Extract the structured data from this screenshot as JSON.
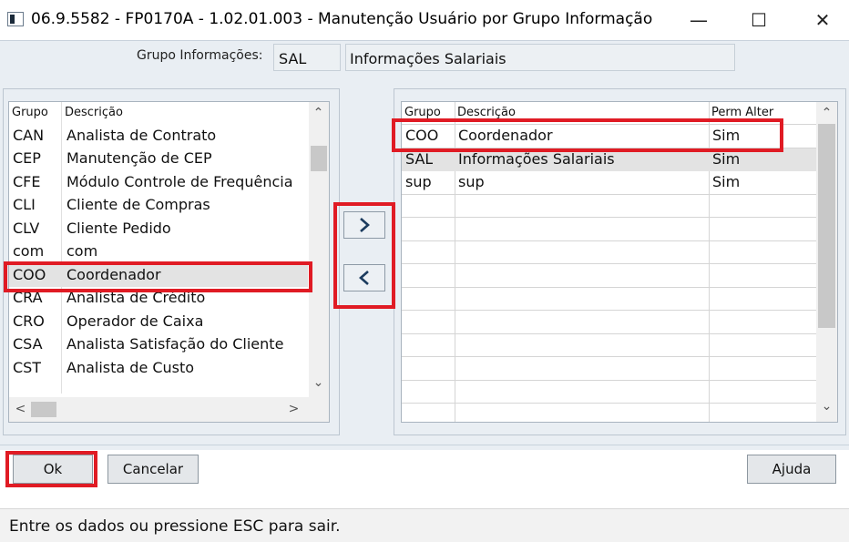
{
  "window": {
    "title": "06.9.5582 - FP0170A - 1.02.01.003 - Manutenção Usuário por Grupo Informação",
    "minimize": "—",
    "maximize": "☐",
    "close": "✕"
  },
  "header": {
    "grupo_label": "Grupo Informações:",
    "grupo_code": "SAL",
    "grupo_desc": "Informações Salariais"
  },
  "left_grid": {
    "col_grupo": "Grupo",
    "col_descricao": "Descrição",
    "rows": [
      {
        "grupo": "CAN",
        "descricao": "Analista de Contrato"
      },
      {
        "grupo": "CEP",
        "descricao": "Manutenção de CEP"
      },
      {
        "grupo": "CFE",
        "descricao": "Módulo Controle de Frequência"
      },
      {
        "grupo": "CLI",
        "descricao": "Cliente de Compras"
      },
      {
        "grupo": "CLV",
        "descricao": "Cliente Pedido"
      },
      {
        "grupo": "com",
        "descricao": "com"
      },
      {
        "grupo": "COO",
        "descricao": "Coordenador"
      },
      {
        "grupo": "CRA",
        "descricao": "Analista de Crédito"
      },
      {
        "grupo": "CRO",
        "descricao": "Operador de Caixa"
      },
      {
        "grupo": "CSA",
        "descricao": "Analista Satisfação do Cliente"
      },
      {
        "grupo": "CST",
        "descricao": "Analista de Custo"
      }
    ]
  },
  "right_grid": {
    "col_grupo": "Grupo",
    "col_descricao": "Descrição",
    "col_perm": "Perm Alter",
    "rows": [
      {
        "grupo": "COO",
        "descricao": "Coordenador",
        "perm": "Sim"
      },
      {
        "grupo": "SAL",
        "descricao": "Informações Salariais",
        "perm": "Sim"
      },
      {
        "grupo": "sup",
        "descricao": "sup",
        "perm": "Sim"
      }
    ]
  },
  "buttons": {
    "move_right": "›",
    "move_left": "‹",
    "ok": "Ok",
    "cancel": "Cancelar",
    "help": "Ajuda"
  },
  "status": "Entre os dados ou pressione ESC para sair.",
  "colors": {
    "highlight_red": "#e01b24",
    "panel_bg": "#e9eef3",
    "selected_row": "#e3e3e3"
  }
}
